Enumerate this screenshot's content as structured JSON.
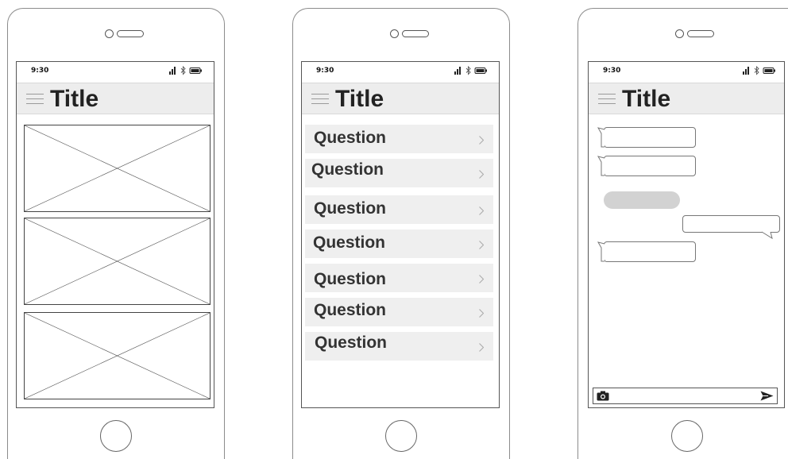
{
  "phones": [
    {
      "status_time": "9:30",
      "title": "Title",
      "content": "image-placeholders"
    },
    {
      "status_time": "9:30",
      "title": "Title",
      "questions": [
        "Question",
        "Question",
        "Question",
        "Question",
        "Question",
        "Question",
        "Question"
      ]
    },
    {
      "status_time": "9:30",
      "title": "Title",
      "chat_input": ""
    }
  ],
  "icons": {
    "status": [
      "signal-icon",
      "bluetooth-icon",
      "battery-icon"
    ],
    "nav": "hamburger-menu-icon",
    "list_item": "chevron-right-icon",
    "chat": [
      "camera-icon",
      "send-icon"
    ]
  }
}
